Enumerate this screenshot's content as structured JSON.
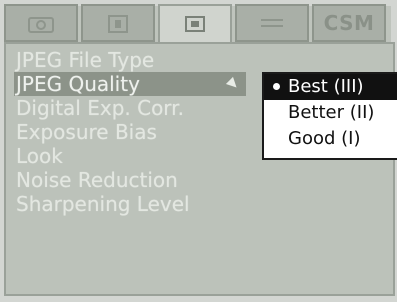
{
  "tabs": [
    {
      "icon": "camera-settings-icon",
      "label": ""
    },
    {
      "icon": "self-timer-icon",
      "label": ""
    },
    {
      "icon": "image-quality-icon",
      "label": "",
      "active": true
    },
    {
      "icon": "flash-icon",
      "label": ""
    },
    {
      "icon": "",
      "label": "CSM"
    }
  ],
  "menu": {
    "items": [
      {
        "label": "JPEG File Type"
      },
      {
        "label": "JPEG Quality",
        "selected": true
      },
      {
        "label": "Digital Exp. Corr."
      },
      {
        "label": "Exposure Bias"
      },
      {
        "label": "Look"
      },
      {
        "label": "Noise Reduction"
      },
      {
        "label": "Sharpening Level"
      }
    ]
  },
  "popup": {
    "options": [
      {
        "label": "Best (III)",
        "selected": true
      },
      {
        "label": "Better (II)"
      },
      {
        "label": "Good (I)"
      }
    ]
  }
}
